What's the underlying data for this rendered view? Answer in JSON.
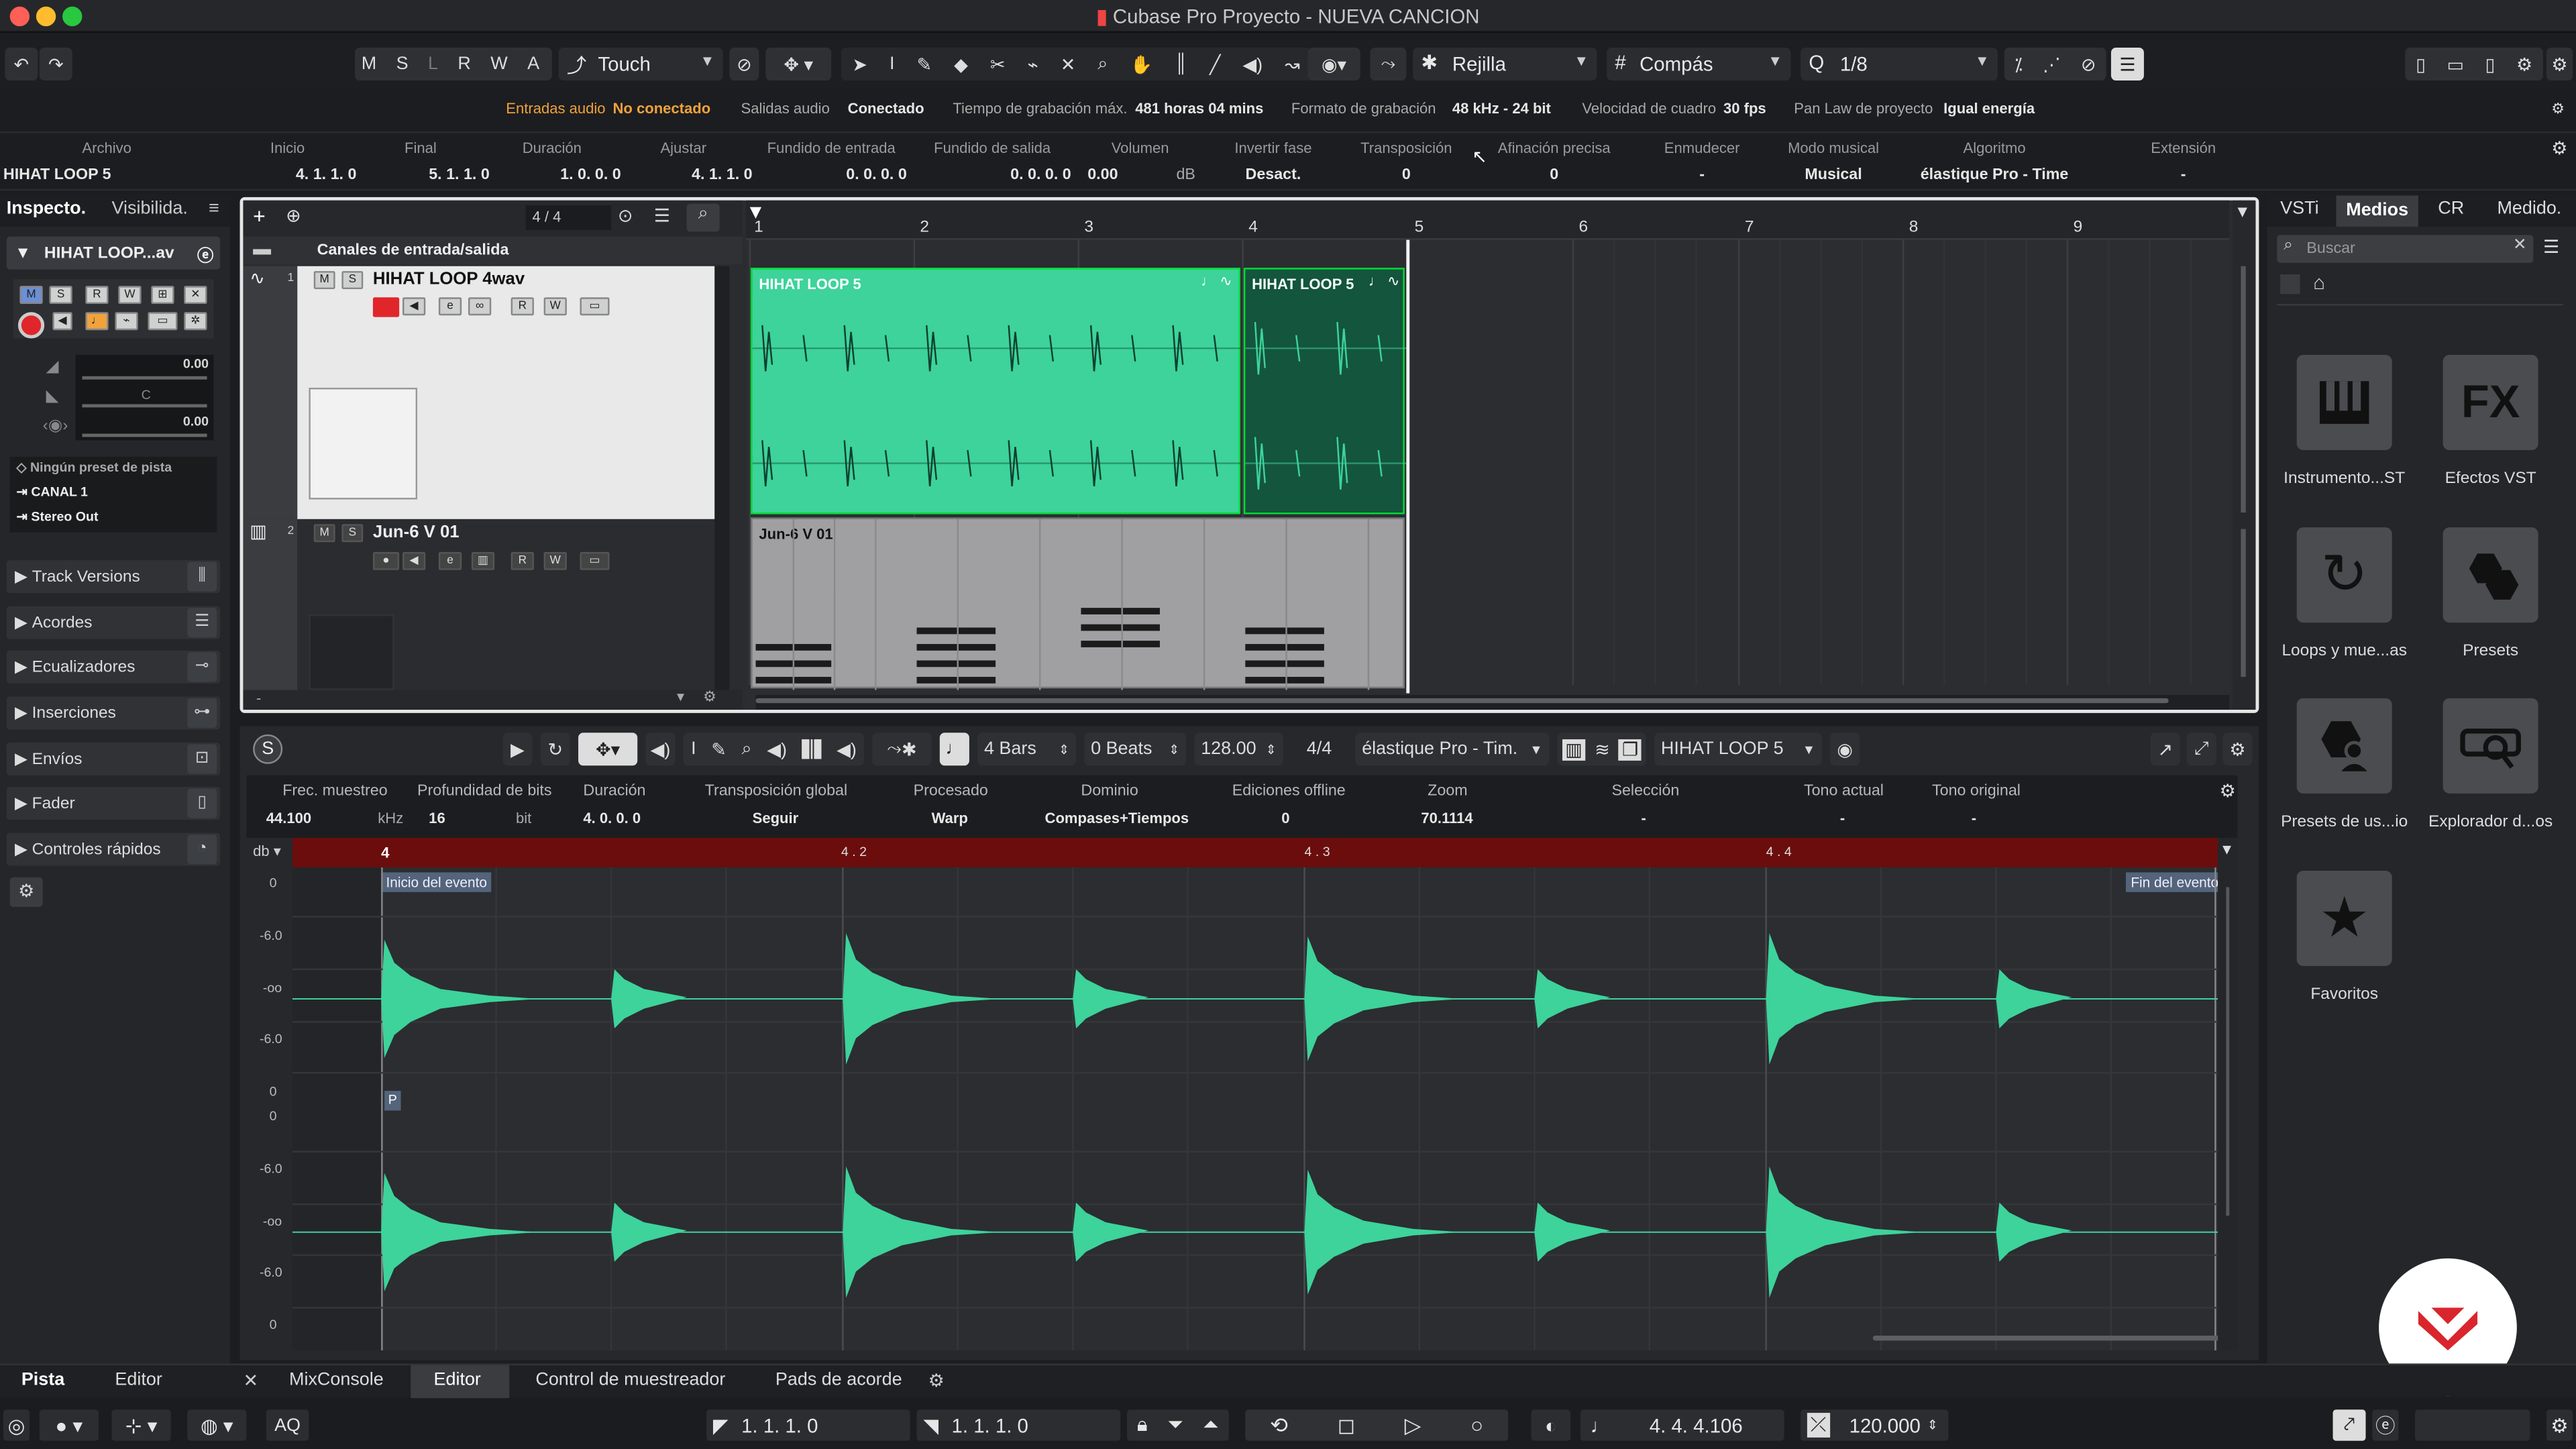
{
  "window": {
    "title": "Cubase Pro Proyecto - NUEVA CANCION"
  },
  "toolbar": {
    "modes": [
      "M",
      "S",
      "L",
      "R",
      "W",
      "A"
    ],
    "automation_mode": "Touch",
    "snap_type": "Rejilla",
    "grid_type": "Compás",
    "quantize": "1/8"
  },
  "status": {
    "audio_in_label": "Entradas audio",
    "audio_in_value": "No conectado",
    "audio_out_label": "Salidas audio",
    "audio_out_value": "Conectado",
    "rec_time_label": "Tiempo de grabación máx.",
    "rec_time_value": "481 horas 04 mins",
    "rec_format_label": "Formato de grabación",
    "rec_format_value": "48 kHz - 24 bit",
    "frame_rate_label": "Velocidad de cuadro",
    "frame_rate_value": "30 fps",
    "pan_law_label": "Pan Law de proyecto",
    "pan_law_value": "Igual energía"
  },
  "infoline": {
    "headers": [
      "Archivo",
      "Inicio",
      "Final",
      "Duración",
      "Ajustar",
      "Fundido de entrada",
      "Fundido de salida",
      "Volumen",
      "Invertir fase",
      "Transposición",
      "Afinación precisa",
      "Enmudecer",
      "Modo musical",
      "Algoritmo",
      "Extensión"
    ],
    "values": [
      "HIHAT LOOP 5",
      "4. 1. 1.   0",
      "5. 1. 1.   0",
      "1. 0. 0.   0",
      "4. 1. 1.   0",
      "0. 0. 0.   0",
      "0. 0. 0.   0",
      "0.00",
      "Desact.",
      "0",
      "0",
      "-",
      "Musical",
      "élastique Pro - Time",
      "-"
    ],
    "volume_unit": "dB"
  },
  "inspector": {
    "tab_inspector": "Inspecto.",
    "tab_visibility": "Visibilida.",
    "track_name": "HIHAT LOOP...av",
    "volume": "0.00",
    "pan": "C",
    "delay": "0.00",
    "preset": "Ningún preset de pista",
    "input": "CANAL 1",
    "output": "Stereo Out",
    "sections": [
      "Track Versions",
      "Acordes",
      "Ecualizadores",
      "Inserciones",
      "Envíos",
      "Fader",
      "Controles rápidos"
    ]
  },
  "project": {
    "signature": "4 / 4",
    "folder": "Canales de entrada/salida",
    "tracks": [
      {
        "num": "1",
        "name": "HIHAT LOOP 4wav",
        "events": [
          "HIHAT LOOP 5",
          "HIHAT LOOP 5"
        ]
      },
      {
        "num": "2",
        "name": "Jun-6 V 01",
        "events": [
          "Jun-6 V 01"
        ]
      }
    ],
    "ruler": [
      "1",
      "2",
      "3",
      "4",
      "5",
      "6",
      "7",
      "8",
      "9"
    ]
  },
  "editor": {
    "length_bars": "4 Bars",
    "length_beats": "0 Beats",
    "tempo": "128.00",
    "signature": "4/4",
    "algorithm": "élastique Pro - Tim.",
    "clip": "HIHAT LOOP 5",
    "headers": [
      "Frec. muestreo",
      "Profundidad de bits",
      "Duración",
      "Transposición global",
      "Procesado",
      "Dominio",
      "Ediciones offline",
      "Zoom",
      "Selección",
      "Tono actual",
      "Tono original"
    ],
    "values": [
      "44.100",
      "16",
      "4. 0. 0.   0",
      "Seguir",
      "Warp",
      "Compases+Tiempos",
      "0",
      "70.1114",
      "-",
      "-",
      "-"
    ],
    "samplerate_unit": "kHz",
    "bits_unit": "bit",
    "unit_menu": "db",
    "ruler": [
      "4",
      "4 . 2",
      "4 . 3",
      "4 . 4"
    ],
    "start_marker": "Inicio del evento",
    "end_marker": "Fin del evento",
    "db_labels": [
      "0",
      "-6.0",
      "-oo",
      "-6.0",
      "0"
    ],
    "p_flag": "P"
  },
  "mediabay": {
    "tabs": [
      "VSTi",
      "Medios",
      "CR",
      "Medido."
    ],
    "search_placeholder": "Buscar",
    "items": [
      {
        "label": "Instrumento...ST",
        "icon": "piano-keys-icon"
      },
      {
        "label": "Efectos VST",
        "icon": "fx-icon"
      },
      {
        "label": "Loops y mue...as",
        "icon": "loop-icon"
      },
      {
        "label": "Presets",
        "icon": "presets-icon"
      },
      {
        "label": "Presets de us...io",
        "icon": "user-presets-icon"
      },
      {
        "label": "Explorador d...os",
        "icon": "browser-icon"
      },
      {
        "label": "Favoritos",
        "icon": "star-icon"
      }
    ],
    "fx_text": "FX"
  },
  "bottom_tabs": {
    "left": [
      "Pista",
      "Editor"
    ],
    "lower": [
      "MixConsole",
      "Editor",
      "Control de muestreador",
      "Pads de acorde"
    ]
  },
  "transport": {
    "left_locator": "1.   1.   1.     0",
    "right_locator": "1.   1.   1.     0",
    "position": "4.   4.   4.106",
    "tempo": "120.000",
    "aq": "AQ"
  },
  "colors": {
    "accent": "#2ecc8a",
    "event": "#3dd39b",
    "event_dark": "#14553d",
    "orange": "#f0a23c",
    "record": "#e0262b",
    "editor_ruler": "#6b0d0d"
  }
}
